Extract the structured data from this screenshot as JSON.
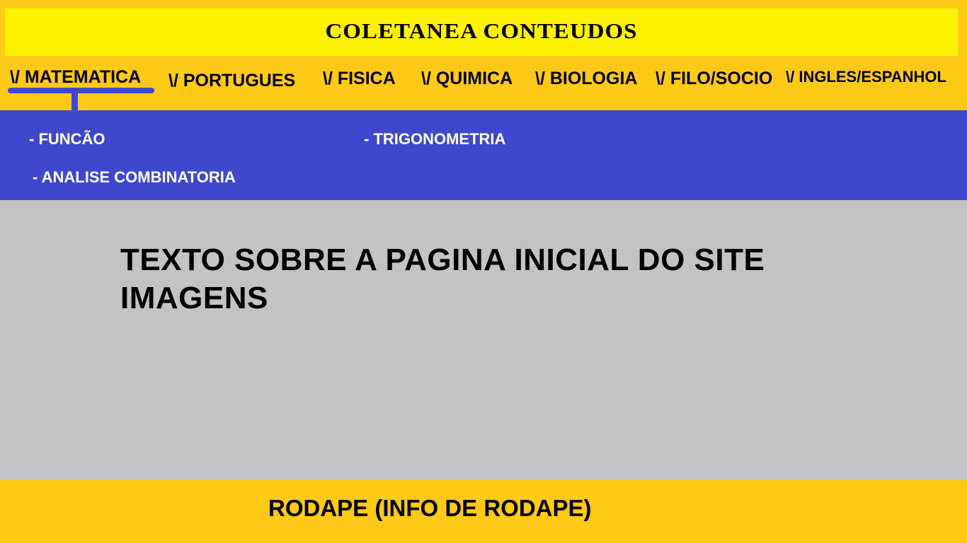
{
  "header": {
    "title": "COLETANEA CONTEUDOS"
  },
  "nav": {
    "active": "matematica",
    "items": [
      {
        "id": "matematica",
        "label": "\\/ MATEMATICA"
      },
      {
        "id": "portugues",
        "label": "\\/ PORTUGUES"
      },
      {
        "id": "fisica",
        "label": "\\/ FISICA"
      },
      {
        "id": "quimica",
        "label": "\\/ QUIMICA"
      },
      {
        "id": "biologia",
        "label": "\\/ BIOLOGIA"
      },
      {
        "id": "filo-socio",
        "label": "\\/ FILO/SOCIO"
      },
      {
        "id": "ingles-espanhol",
        "label": "\\/ INGLES/ESPANHOL"
      }
    ]
  },
  "submenu": {
    "items": [
      {
        "label": "- FUNCÃO"
      },
      {
        "label": "- TRIGONOMETRIA"
      },
      {
        "label": "- ANALISE COMBINATORIA"
      }
    ]
  },
  "main": {
    "line1": "TEXTO SOBRE A PAGINA INICIAL DO SITE",
    "line2": "IMAGENS"
  },
  "footer": {
    "text": "RODAPE (INFO DE RODAPE)"
  },
  "colors": {
    "header_bg": "#ffc917",
    "title_bar_bg": "#fff200",
    "submenu_bg": "#3f48cc",
    "content_bg": "#c3c3c3",
    "text": "#000000",
    "submenu_text": "#ffffff"
  }
}
